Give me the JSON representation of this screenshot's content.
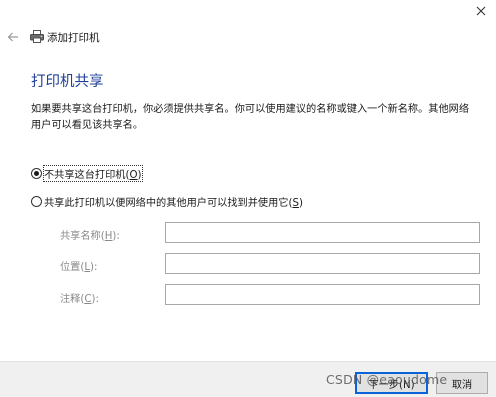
{
  "window": {
    "close_icon": "close-icon"
  },
  "header": {
    "back_icon": "back-arrow-icon",
    "printer_icon": "printer-icon",
    "title": "添加打印机"
  },
  "main": {
    "heading": "打印机共享",
    "description": "如果要共享这台打印机，你必须提供共享名。你可以使用建议的名称或键入一个新名称。其他网络用户可以看见该共享名。",
    "option_no_share": {
      "text": "不共享这台打印机(",
      "key": "O",
      "suffix": ")",
      "checked": true
    },
    "option_share": {
      "text": "共享此打印机以便网络中的其他用户可以找到并使用它(",
      "key": "S",
      "suffix": ")",
      "checked": false
    },
    "fields": [
      {
        "text": "共享名称(",
        "key": "H",
        "suffix": "):",
        "value": ""
      },
      {
        "text": "位置(",
        "key": "L",
        "suffix": "):",
        "value": ""
      },
      {
        "text": "注释(",
        "key": "C",
        "suffix": "):",
        "value": ""
      }
    ]
  },
  "footer": {
    "next_label": "下一步(N)",
    "cancel_label": "取消"
  },
  "watermark": "CSDN @eaoudome"
}
